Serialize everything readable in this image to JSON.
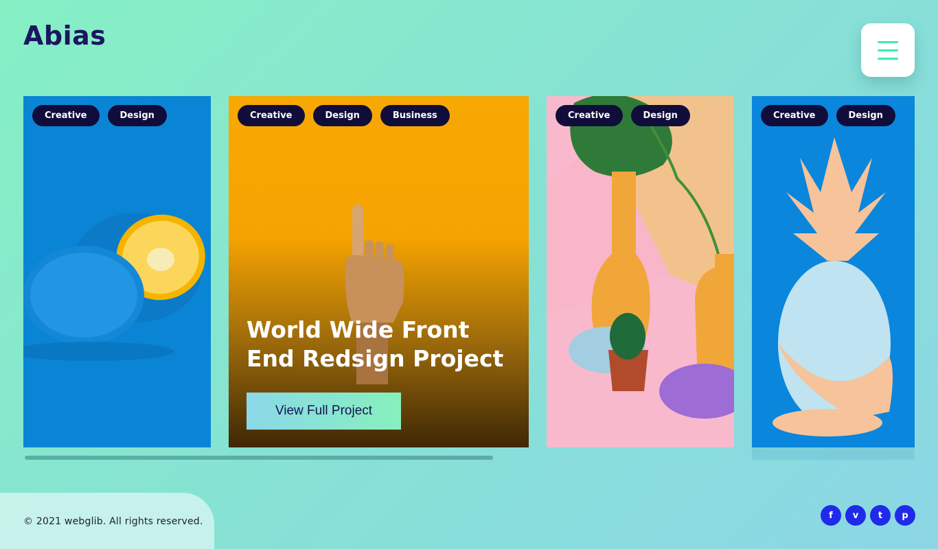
{
  "brand": {
    "logo": "Abias"
  },
  "menu": {
    "icon": "hamburger-menu-icon"
  },
  "cards": [
    {
      "image": "blue-orange-photo",
      "tags": [
        "Creative",
        "Design"
      ]
    },
    {
      "image": "wooden-hand-photo",
      "tags": [
        "Creative",
        "Design",
        "Business"
      ],
      "title": "World Wide Front End Redsign Project",
      "button": "View Full Project"
    },
    {
      "image": "vases-cactus-photo",
      "tags": [
        "Creative",
        "Design"
      ]
    },
    {
      "image": "painted-pineapple-photo",
      "tags": [
        "Creative",
        "Design"
      ]
    }
  ],
  "footer": {
    "copyright": "© 2021 webglib. All rights reserved.",
    "socials": [
      {
        "name": "facebook-icon",
        "glyph": "f"
      },
      {
        "name": "vimeo-icon",
        "glyph": "v"
      },
      {
        "name": "twitter-icon",
        "glyph": "t"
      },
      {
        "name": "pinterest-icon",
        "glyph": "p"
      }
    ]
  },
  "colors": {
    "accent": "#3ee8b3",
    "tag_bg": "#110d3a",
    "social_bg": "#1f2be8",
    "logo": "#1b1660"
  }
}
